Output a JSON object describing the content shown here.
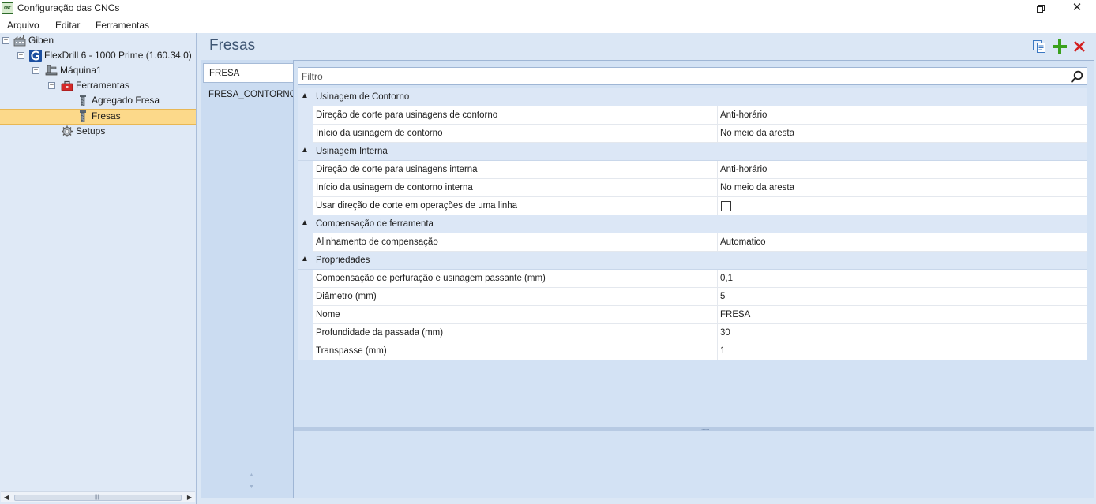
{
  "window": {
    "title": "Configuração das CNCs",
    "app_icon_text": "CNC"
  },
  "menu": [
    "Arquivo",
    "Editar",
    "Ferramentas"
  ],
  "tree": {
    "root": "Giben",
    "machine_model": "FlexDrill 6 - 1000 Prime (1.60.34.0)",
    "machine": "Máquina1",
    "tools_folder": "Ferramentas",
    "tool_1": "Agregado Fresa",
    "tool_2": "Fresas",
    "setups": "Setups",
    "selected": "Fresas"
  },
  "page": {
    "title": "Fresas"
  },
  "tabs": [
    "FRESA",
    "FRESA_CONTORNO"
  ],
  "active_tab": "FRESA",
  "filter": {
    "placeholder": "Filtro"
  },
  "grid": {
    "sections": [
      {
        "title": "Usinagem de Contorno",
        "props": [
          {
            "name": "Direção de corte para usinagens de contorno",
            "value": "Anti-horário"
          },
          {
            "name": "Início da usinagem de contorno",
            "value": "No meio da aresta"
          }
        ]
      },
      {
        "title": "Usinagem Interna",
        "props": [
          {
            "name": "Direção de corte para usinagens interna",
            "value": "Anti-horário"
          },
          {
            "name": "Início da usinagem de contorno interna",
            "value": "No meio da aresta"
          },
          {
            "name": "Usar direção de corte em operações de uma linha",
            "value": "",
            "checkbox": true,
            "checked": false
          }
        ]
      },
      {
        "title": "Compensação de ferramenta",
        "props": [
          {
            "name": "Alinhamento de compensação",
            "value": "Automatico"
          }
        ]
      },
      {
        "title": "Propriedades",
        "props": [
          {
            "name": "Compensação de perfuração e usinagem passante (mm)",
            "value": "0,1"
          },
          {
            "name": "Diâmetro (mm)",
            "value": "5"
          },
          {
            "name": "Nome",
            "value": "FRESA"
          },
          {
            "name": "Profundidade da passada (mm)",
            "value": "30"
          },
          {
            "name": "Transpasse (mm)",
            "value": "1"
          }
        ]
      }
    ]
  },
  "colors": {
    "selection": "#fcd98a",
    "panel_bg": "#dbe7f5",
    "add_icon": "#3aa11d",
    "delete_icon": "#d32020"
  }
}
